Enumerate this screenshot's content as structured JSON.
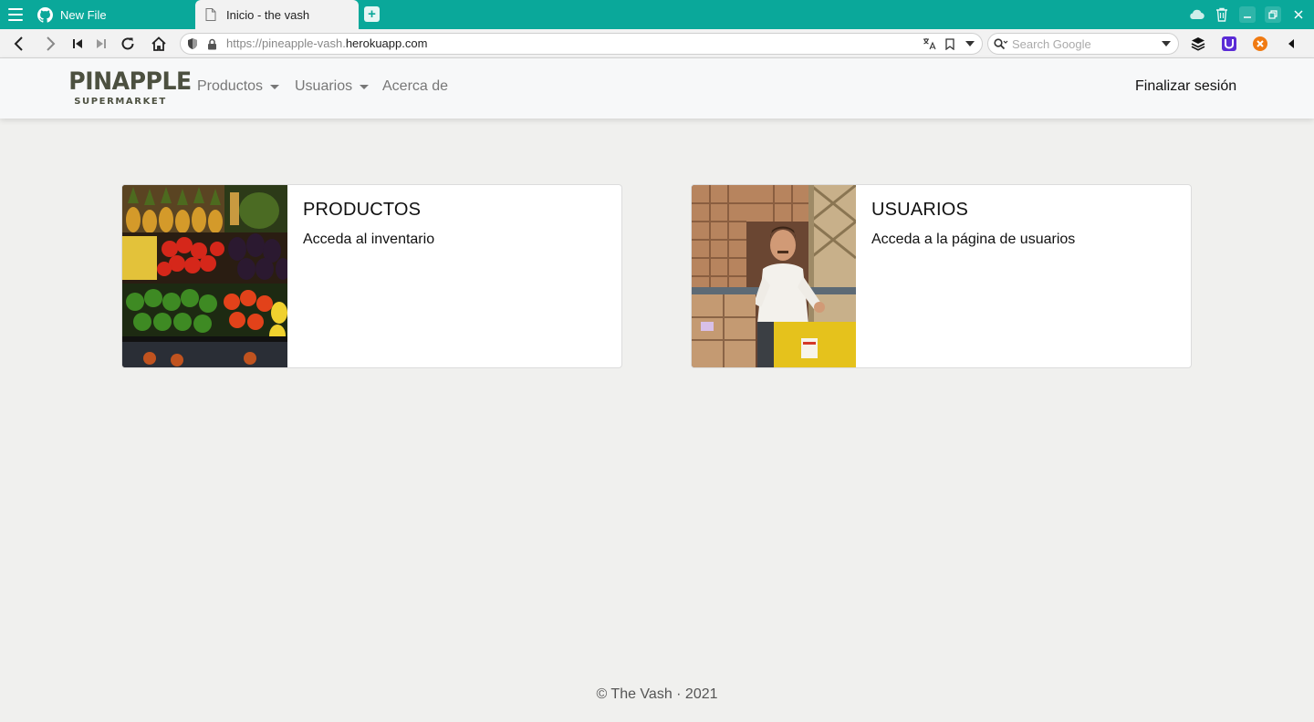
{
  "browser": {
    "tabs": [
      {
        "title": "New File",
        "icon": "github-icon",
        "active": false
      },
      {
        "title": "Inicio - the vash",
        "icon": "page-icon",
        "active": true
      }
    ],
    "url_prefix": "https://pineapple-vash.",
    "url_domain": "herokuapp.com",
    "search_placeholder": "Search Google",
    "accent_color": "#0aa89a"
  },
  "navbar": {
    "brand_name": "PINAPPLE",
    "brand_sub": "SUPERMARKET",
    "links": [
      {
        "label": "Productos",
        "dropdown": true
      },
      {
        "label": "Usuarios",
        "dropdown": true
      },
      {
        "label": "Acerca de",
        "dropdown": false
      }
    ],
    "logout_label": "Finalizar sesión"
  },
  "cards": [
    {
      "title": "PRODUCTOS",
      "text": "Acceda al inventario",
      "image": "produce-stand-photo"
    },
    {
      "title": "USUARIOS",
      "text": "Acceda a la página de usuarios",
      "image": "warehouse-worker-photo"
    }
  ],
  "footer": {
    "text": "© The Vash · 2021"
  }
}
